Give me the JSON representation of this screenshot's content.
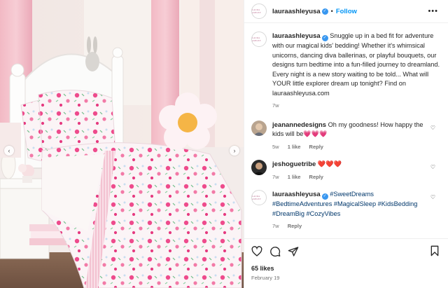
{
  "header": {
    "username": "lauraashleyusa",
    "separator": "•",
    "follow_label": "Follow",
    "more_label": "•••",
    "avatar_mark": "LAURA ASHLEY"
  },
  "caption": {
    "username": "lauraashleyusa",
    "text": "Snuggle up in a bed fit for adventure with our magical kids' bedding! Whether it's whimsical unicorns, dancing diva ballerinas, or playful bouquets, our designs turn bedtime into a fun-filled journey to dreamland. Every night is a new story waiting to be told... What will YOUR little explorer dream up tonight? Find on lauraashleyusa.com",
    "time": "7w"
  },
  "comments": [
    {
      "username": "jeanannedesigns",
      "text": "Oh my goodness! How happy the kids will be",
      "emoji": "💗💗💗",
      "time": "5w",
      "likes": "1 like",
      "reply": "Reply"
    },
    {
      "username": "jeshoguetribe",
      "text": "",
      "emoji": "❤️❤️❤️",
      "time": "7w",
      "likes": "1 like",
      "reply": "Reply"
    },
    {
      "username": "lauraashleyusa",
      "text": "#SweetDreams #BedtimeAdventures #MagicalSleep #KidsBedding #DreamBig #CozyVibes",
      "time": "7w",
      "reply": "Reply"
    }
  ],
  "footer": {
    "likes": "65 likes",
    "date": "February 19"
  },
  "icons": [
    "heart-icon",
    "comment-icon",
    "share-icon",
    "bookmark-icon",
    "verified-badge-icon",
    "chevron-left-icon",
    "chevron-right-icon"
  ],
  "colors": {
    "link": "#00376b",
    "follow": "#0095f6",
    "verified": "#3897f0",
    "heart_pink": "#ec4f94"
  }
}
